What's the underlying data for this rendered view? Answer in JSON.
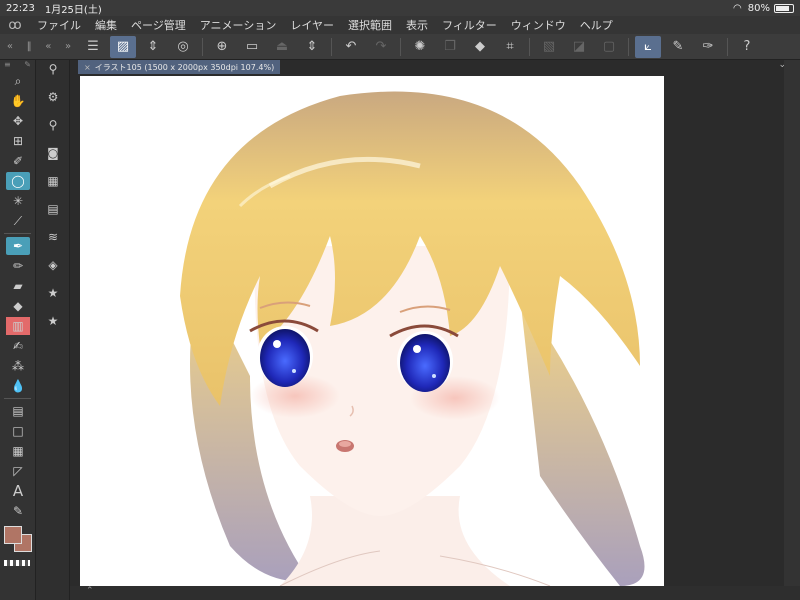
{
  "status": {
    "time": "22:23",
    "date": "1月25日(土)",
    "battery": "80%",
    "wifi_icon": "wifi-icon"
  },
  "menu": {
    "items": [
      "ファイル",
      "編集",
      "ページ管理",
      "アニメーション",
      "レイヤー",
      "選択範囲",
      "表示",
      "フィルター",
      "ウィンドウ",
      "ヘルプ"
    ]
  },
  "tab": {
    "title": "イラスト105 (1500 x 2000px 350dpi 107.4%)"
  },
  "colors": {
    "main": "#b07565",
    "sub": "#b07565",
    "selected_tool": "#4a9fb8",
    "active_toolbar": "#5a6f8f"
  },
  "tools": [
    "magnifier-icon",
    "hand-icon",
    "move-icon",
    "layer-move-icon",
    "operation-icon",
    "lasso-icon",
    "auto-select-icon",
    "eyedropper-icon",
    "pen-icon",
    "pencil-icon",
    "eraser-icon",
    "fill-icon",
    "blend-icon",
    "airbrush-icon",
    "decoration-icon",
    "watercolor-icon",
    "gradient-icon",
    "figure-icon",
    "frame-icon",
    "ruler-icon",
    "text-icon",
    "balloon-icon"
  ]
}
